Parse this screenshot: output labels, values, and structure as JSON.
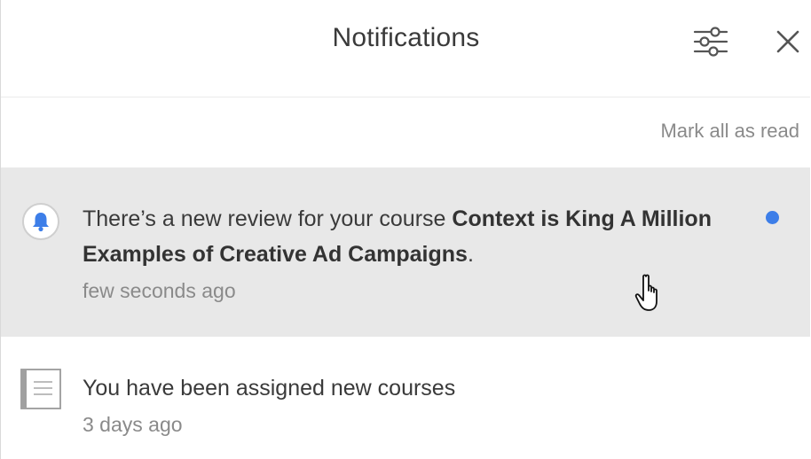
{
  "header": {
    "title": "Notifications",
    "settings_icon": "sliders-icon",
    "close_icon": "close-icon"
  },
  "actions": {
    "mark_all_read": "Mark all as read"
  },
  "notifications": [
    {
      "icon": "bell-icon",
      "text_prefix": "There’s a new review for your course ",
      "text_bold": "Context is King A Million Examples of Creative Ad Campaigns",
      "text_suffix": ".",
      "time": "few seconds ago",
      "unread": true
    },
    {
      "icon": "document-icon",
      "text": "You have been assigned new courses",
      "time": "3 days ago",
      "unread": false
    }
  ],
  "colors": {
    "unread_background": "#e8e8e8",
    "unread_dot": "#3d7ee8",
    "bell_fill": "#3d7ee8"
  }
}
